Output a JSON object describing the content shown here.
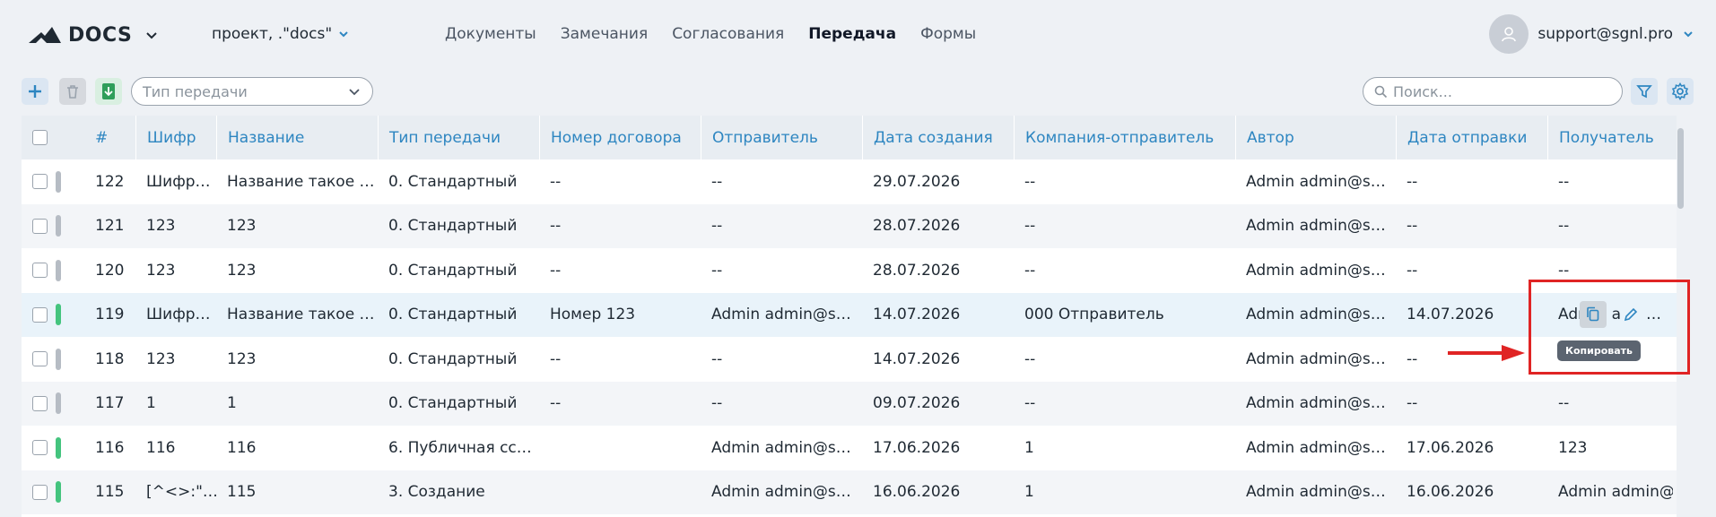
{
  "header": {
    "logo_text": "DOCS",
    "project": "проект, .\"docs\"",
    "nav": [
      "Документы",
      "Замечания",
      "Согласования",
      "Передача",
      "Формы"
    ],
    "active_nav": "Передача",
    "user_email": "support@sgnl.pro"
  },
  "toolbar": {
    "transfer_type_placeholder": "Тип передачи",
    "search_placeholder": "Поиск..."
  },
  "table": {
    "columns": [
      "#",
      "Шифр",
      "Название",
      "Тип передачи",
      "Номер договора",
      "Отправитель",
      "Дата создания",
      "Компания-отправитель",
      "Автор",
      "Дата отправки",
      "Получатель"
    ],
    "rows": [
      {
        "status": "gray",
        "id": "122",
        "code": "Шифр…",
        "name": "Название такое …",
        "type": "0. Стандартный",
        "contract": "--",
        "sender": "--",
        "created": "29.07.2026",
        "company": "--",
        "author": "Admin admin@s…",
        "sent": "--",
        "recipient": "--"
      },
      {
        "status": "gray",
        "id": "121",
        "code": "123",
        "name": "123",
        "type": "0. Стандартный",
        "contract": "--",
        "sender": "--",
        "created": "28.07.2026",
        "company": "--",
        "author": "Admin admin@s…",
        "sent": "--",
        "recipient": "--"
      },
      {
        "status": "gray",
        "id": "120",
        "code": "123",
        "name": "123",
        "type": "0. Стандартный",
        "contract": "--",
        "sender": "--",
        "created": "28.07.2026",
        "company": "--",
        "author": "Admin admin@s…",
        "sent": "--",
        "recipient": "--"
      },
      {
        "status": "green",
        "id": "119",
        "code": "Шифр…",
        "name": "Название такое …",
        "type": "0. Стандартный",
        "contract": "Номер 123",
        "sender": "Admin admin@s…",
        "created": "14.07.2026",
        "company": "000 Отправитель",
        "author": "Admin admin@s…",
        "sent": "14.07.2026",
        "recipient": "Admin a"
      },
      {
        "status": "gray",
        "id": "118",
        "code": "123",
        "name": "123",
        "type": "0. Стандартный",
        "contract": "--",
        "sender": "--",
        "created": "14.07.2026",
        "company": "--",
        "author": "Admin admin@s…",
        "sent": "--",
        "recipient": "--"
      },
      {
        "status": "gray",
        "id": "117",
        "code": "1",
        "name": "1",
        "type": "0. Стандартный",
        "contract": "--",
        "sender": "--",
        "created": "09.07.2026",
        "company": "--",
        "author": "Admin admin@s…",
        "sent": "--",
        "recipient": "--"
      },
      {
        "status": "green",
        "id": "116",
        "code": "116",
        "name": "116",
        "type": "6. Публичная сс…",
        "contract": "",
        "sender": "Admin admin@s…",
        "created": "17.06.2026",
        "company": "1",
        "author": "Admin admin@s…",
        "sent": "17.06.2026",
        "recipient": "123"
      },
      {
        "status": "green",
        "id": "115",
        "code": "[^<>:\"…",
        "name": "115",
        "type": "3. Создание",
        "contract": "",
        "sender": "Admin admin@s…",
        "created": "16.06.2026",
        "company": "1",
        "author": "Admin admin@s…",
        "sent": "16.06.2026",
        "recipient": "Admin admin@s…"
      }
    ]
  },
  "row_actions": {
    "more": "…",
    "copy_tooltip": "Копировать"
  },
  "colors": {
    "accent": "#2e86c1",
    "status_green": "#44c47e",
    "status_gray": "#b6bcc4",
    "callout_red": "#e02424"
  },
  "icons": [
    "logo-mountain-icon",
    "chevron-down-icon",
    "user-icon",
    "plus-icon",
    "trash-icon",
    "download-icon",
    "search-icon",
    "filter-icon",
    "gear-icon",
    "copy-icon",
    "pencil-icon",
    "arrow-right-icon"
  ]
}
